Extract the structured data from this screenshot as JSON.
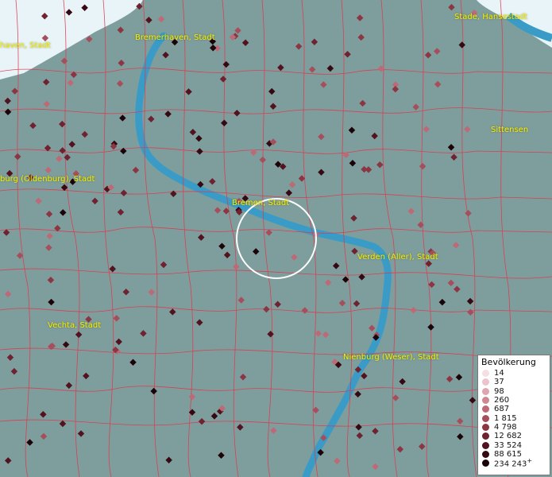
{
  "colors": {
    "land": "#7e9e9e",
    "river": "#3a9cc6",
    "sea": "#e8f4f8",
    "boundary": "#e0384a",
    "label": "#f6f000",
    "focus_ring": "#ffffff"
  },
  "places": [
    {
      "id": "bremerhaven",
      "label": "Bremerhaven, Stadt"
    },
    {
      "id": "nordenham",
      "label": "haven, Stadt"
    },
    {
      "id": "stade",
      "label": "Stade, Hansestadt"
    },
    {
      "id": "sittensen",
      "label": "Sittensen"
    },
    {
      "id": "oldenburg",
      "label": "burg (Oldenburg), Stadt"
    },
    {
      "id": "bremen",
      "label": "Bremen, Stadt"
    },
    {
      "id": "verden",
      "label": "Verden (Aller), Stadt"
    },
    {
      "id": "vechta",
      "label": "Vechta, Stadt"
    },
    {
      "id": "nienburg",
      "label": "Nienburg (Weser), Stadt"
    }
  ],
  "legend": {
    "title": "Bevölkerung",
    "classes": [
      {
        "label": "14",
        "color": "#f5dee4"
      },
      {
        "label": "37",
        "color": "#ecc4cc"
      },
      {
        "label": "98",
        "color": "#dea6b0"
      },
      {
        "label": "260",
        "color": "#cf8893"
      },
      {
        "label": "687",
        "color": "#bd6a76"
      },
      {
        "label": "1 815",
        "color": "#a64f5c"
      },
      {
        "label": "4 798",
        "color": "#8c3644"
      },
      {
        "label": "12 682",
        "color": "#6f2230"
      },
      {
        "label": "33 524",
        "color": "#52131f"
      },
      {
        "label": "88 615",
        "color": "#360912"
      },
      {
        "label": "234 243",
        "color": "#1c0308",
        "suffix": "+"
      }
    ]
  }
}
